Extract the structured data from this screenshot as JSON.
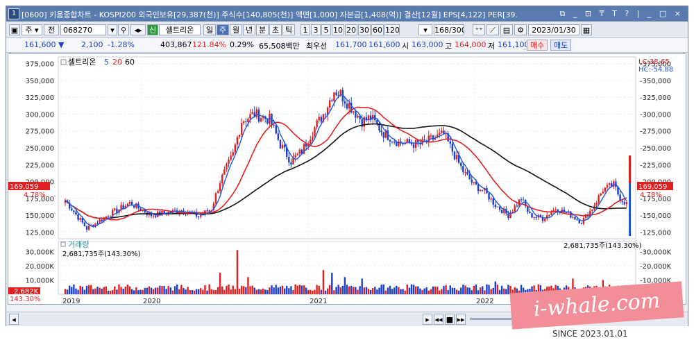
{
  "titlebar": {
    "icon_label": "1",
    "text": "[0600] 키움종합차트 - KOSPI200 외국인보유[29,387(천)] 주식수[140,805(천)] 액면[1,000] 자본금[1,408(억)] 결산[12월] EPS[4,122] PER[39.",
    "controls": "⧉ _ ⊡ ₸ T ? | _ □ ×"
  },
  "toolbar": {
    "market": "주",
    "prefix": "전",
    "code": "068270",
    "stock_badge": "신",
    "stock_name": "셀트리온",
    "periods": [
      "일",
      "주",
      "월",
      "년",
      "분",
      "초",
      "틱"
    ],
    "selected_period": "주",
    "intervals": [
      "1",
      "3",
      "5",
      "10",
      "20",
      "30",
      "60",
      "120"
    ],
    "count": "168",
    "count_total": "/300",
    "date": "2023/01/30"
  },
  "quote": {
    "price": "161,600 ▼",
    "change": "2,100",
    "change_pct": "-1.28%",
    "volume": "403,867",
    "vol_ratio": "121.84%",
    "turnover": "0.29%",
    "amount": "65,508백만",
    "best_ask_label": "최우선",
    "best_ask1": "161,700",
    "best_ask2": "161,600",
    "open_label": "시",
    "open": "163,000",
    "high_label": "고",
    "high": "164,000",
    "low_label": "저",
    "low": "161,100",
    "buy_label": "매수",
    "sell_label": "매도"
  },
  "price_panel": {
    "legend_name": "셀트리온",
    "ma_labels": [
      "5",
      "20",
      "60"
    ],
    "y_ticks": [
      "375,000",
      "350,000",
      "325,000",
      "300,000",
      "275,000",
      "250,000",
      "225,000",
      "200,000",
      "175,000",
      "150,000",
      "125,000"
    ],
    "current_price": "169,059",
    "current_pct": "4.78%",
    "lc_label": "LC:38.65",
    "hc_label": "HC:-54.88"
  },
  "volume_panel": {
    "title": "거래량",
    "left_value": "2,681,735주(143.30%)",
    "right_value": "2,681,735주(143.30%)",
    "y_ticks": [
      "30,000K",
      "20,000K",
      "10,000K"
    ],
    "current": "2,682K",
    "current_pct": "143.30%"
  },
  "x_axis": [
    "2019",
    "2020",
    "2021",
    "2022"
  ],
  "watermark": {
    "text": "i-whale.com",
    "since": "SINCE 2023.01.01"
  },
  "colors": {
    "up": "#e02020",
    "down": "#1a3fc8",
    "ma5": "#2255dd",
    "ma20": "#e02020",
    "ma60": "#111111",
    "title_bg": "#5a7bb0"
  }
}
